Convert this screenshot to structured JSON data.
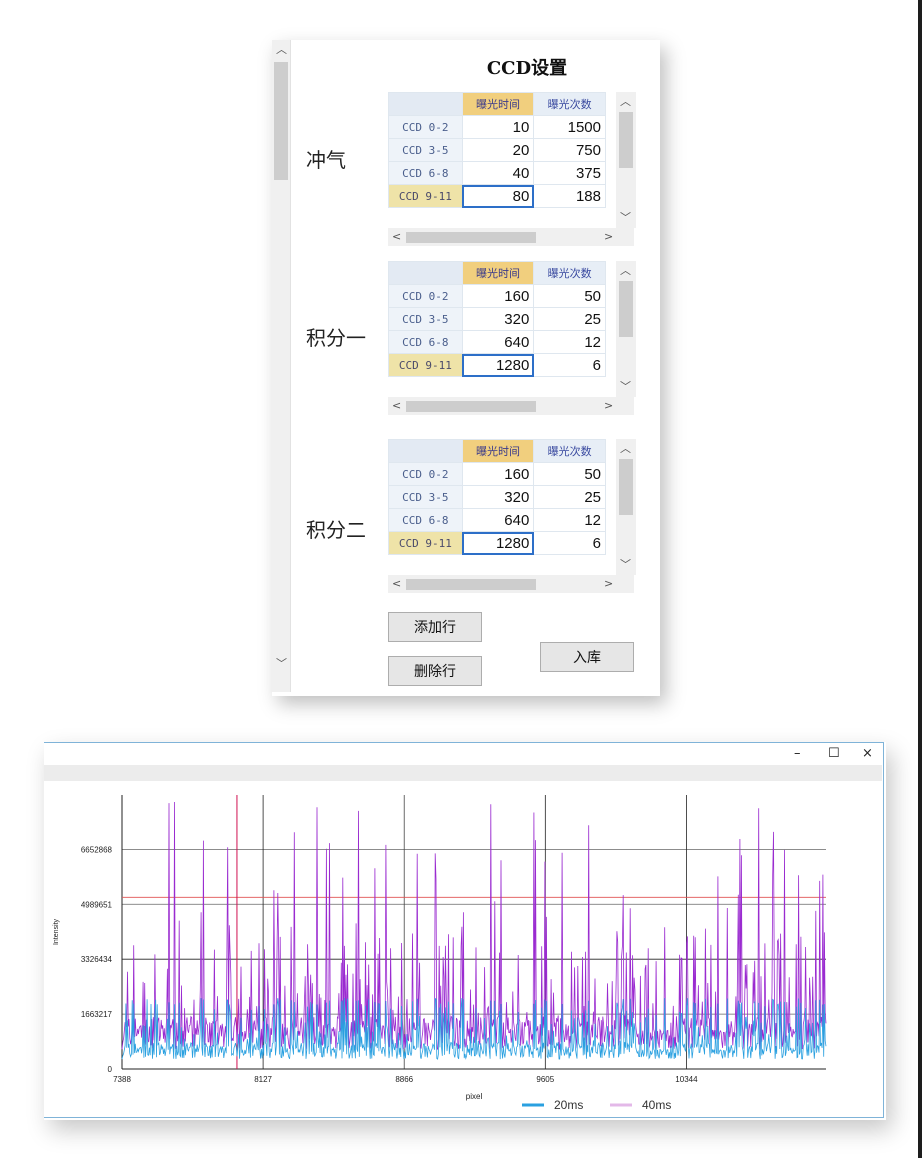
{
  "ccd_panel": {
    "title": "CCD设置",
    "column_headers": [
      "曝光时间",
      "曝光次数"
    ],
    "sections": [
      {
        "label": "冲气",
        "rows": [
          {
            "ccd": "CCD 0-2",
            "exposure_time": "10",
            "exposure_count": "1500"
          },
          {
            "ccd": "CCD 3-5",
            "exposure_time": "20",
            "exposure_count": "750"
          },
          {
            "ccd": "CCD 6-8",
            "exposure_time": "40",
            "exposure_count": "375"
          },
          {
            "ccd": "CCD 9-11",
            "exposure_time": "80",
            "exposure_count": "188"
          }
        ]
      },
      {
        "label": "积分一",
        "rows": [
          {
            "ccd": "CCD 0-2",
            "exposure_time": "160",
            "exposure_count": "50"
          },
          {
            "ccd": "CCD 3-5",
            "exposure_time": "320",
            "exposure_count": "25"
          },
          {
            "ccd": "CCD 6-8",
            "exposure_time": "640",
            "exposure_count": "12"
          },
          {
            "ccd": "CCD 9-11",
            "exposure_time": "1280",
            "exposure_count": "6"
          }
        ]
      },
      {
        "label": "积分二",
        "rows": [
          {
            "ccd": "CCD 0-2",
            "exposure_time": "160",
            "exposure_count": "50"
          },
          {
            "ccd": "CCD 3-5",
            "exposure_time": "320",
            "exposure_count": "25"
          },
          {
            "ccd": "CCD 6-8",
            "exposure_time": "640",
            "exposure_count": "12"
          },
          {
            "ccd": "CCD 9-11",
            "exposure_time": "1280",
            "exposure_count": "6"
          }
        ]
      }
    ],
    "buttons": {
      "add_row": "添加行",
      "delete_row": "删除行",
      "save_db": "入库"
    },
    "icons": {
      "scroll_up": "chevron-up-icon",
      "scroll_down": "chevron-down-icon",
      "scroll_left": "chevron-left-icon",
      "scroll_right": "chevron-right-icon"
    }
  },
  "chart_window": {
    "controls": {
      "minimize": "–",
      "maximize": "☐",
      "close": "×"
    }
  },
  "chart_data": {
    "type": "line",
    "xlabel": "pixel",
    "ylabel": "Intensity",
    "x_ticks": [
      "7388",
      "8127",
      "8866",
      "9605",
      "10344"
    ],
    "y_ticks": [
      "0",
      "1663217",
      "3326434",
      "4989651",
      "6652868"
    ],
    "xlim": [
      7388,
      11075
    ],
    "ylim": [
      0,
      8300000
    ],
    "grid": true,
    "legend_position": "bottom-center",
    "threshold_line": {
      "value": 5200000,
      "color": "#e05050"
    },
    "series": [
      {
        "name": "20ms",
        "color": "#2aa0e0",
        "saturation_level": 2150000
      },
      {
        "name": "40ms",
        "color": "#9a2bd0",
        "saturation_level": 8300000
      }
    ]
  }
}
